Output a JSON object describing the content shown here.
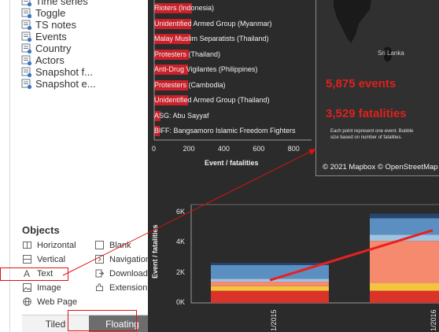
{
  "sidebar": {
    "sheets": [
      {
        "label": "Time series",
        "icon": "sheet-icon"
      },
      {
        "label": "Toggle",
        "icon": "sheet-icon"
      },
      {
        "label": "TS notes",
        "icon": "sheet-icon"
      },
      {
        "label": "Events",
        "icon": "sheet-icon"
      },
      {
        "label": "Country",
        "icon": "sheet-icon"
      },
      {
        "label": "Actors",
        "icon": "sheet-icon"
      },
      {
        "label": "Snapshot f...",
        "icon": "sheet-icon"
      },
      {
        "label": "Snapshot e...",
        "icon": "sheet-icon"
      }
    ],
    "objects_title": "Objects",
    "objects": {
      "horizontal": "Horizontal",
      "blank": "Blank",
      "vertical": "Vertical",
      "navigation": "Navigation",
      "text": "Text",
      "download": "Download",
      "image": "Image",
      "extension": "Extension",
      "web_page": "Web Page"
    },
    "layout_mode": {
      "tiled": "Tiled",
      "floating": "Floating",
      "selected": "Floating"
    }
  },
  "dashboard": {
    "actors_chart": {
      "rows": [
        {
          "label": "Rioters (Indonesia)"
        },
        {
          "label": "Unidentified Armed Group (Myanmar)"
        },
        {
          "label": "Malay Muslim Separatists (Thailand)"
        },
        {
          "label": "Protesters (Thailand)"
        },
        {
          "label": "Anti-Drug Vigilantes (Philippines)"
        },
        {
          "label": "Protesters (Cambodia)"
        },
        {
          "label": "Unidentified Armed Group (Thailand)"
        },
        {
          "label": "ASG: Abu Sayyaf"
        },
        {
          "label": "BIFF: Bangsamoro Islamic Freedom Fighters"
        }
      ],
      "x_ticks": [
        "0",
        "200",
        "400",
        "600",
        "800"
      ],
      "x_title": "Event / fatalities"
    },
    "map_panel": {
      "place_label": "Sri Lanka",
      "events_stat": "5,875 events",
      "fatalities_stat": "3,529 fatalities",
      "note": "Each point represent one event. Bubble size based on number of fatalities.",
      "copyright": "© 2021 Mapbox © OpenStreetMap"
    },
    "timeseries_chart": {
      "y_title": "Event / fatalities",
      "y_ticks": [
        "6K",
        "4K",
        "2K",
        "0K"
      ],
      "x_ticks": [
        "1/2015",
        "1/2016"
      ]
    }
  },
  "chart_data": [
    {
      "type": "bar",
      "orientation": "horizontal",
      "categories": [
        "Rioters (Indonesia)",
        "Unidentified Armed Group (Myanmar)",
        "Malay Muslim Separatists (Thailand)",
        "Protesters (Thailand)",
        "Anti-Drug Vigilantes (Philippines)",
        "Protesters (Cambodia)",
        "Unidentified Armed Group (Thailand)",
        "ASG: Abu Sayyaf",
        "BIFF: Bangsamoro Islamic Freedom Fighters"
      ],
      "values": [
        215,
        210,
        205,
        200,
        195,
        195,
        195,
        35,
        30
      ],
      "xlabel": "Event / fatalities",
      "xlim": [
        0,
        900
      ],
      "x_ticks": [
        0,
        200,
        400,
        600,
        800
      ]
    },
    {
      "type": "bar",
      "stacked": true,
      "categories": [
        "1/2015",
        "1/2016"
      ],
      "ylabel": "Event / fatalities",
      "ylim": [
        0,
        6500
      ],
      "y_ticks": [
        0,
        2000,
        4000,
        6000
      ],
      "series": [
        {
          "color": "#d9332a",
          "values": [
            800,
            800
          ]
        },
        {
          "color": "#f2c53d",
          "values": [
            300,
            500
          ]
        },
        {
          "color": "#f58a6e",
          "values": [
            300,
            2800
          ]
        },
        {
          "color": "#9fc3e0",
          "values": [
            200,
            400
          ]
        },
        {
          "color": "#5b8ec1",
          "values": [
            900,
            1100
          ]
        },
        {
          "color": "#27466e",
          "values": [
            150,
            300
          ]
        }
      ],
      "line": {
        "color": "#e82020",
        "values": [
          1500,
          4800
        ]
      }
    }
  ]
}
